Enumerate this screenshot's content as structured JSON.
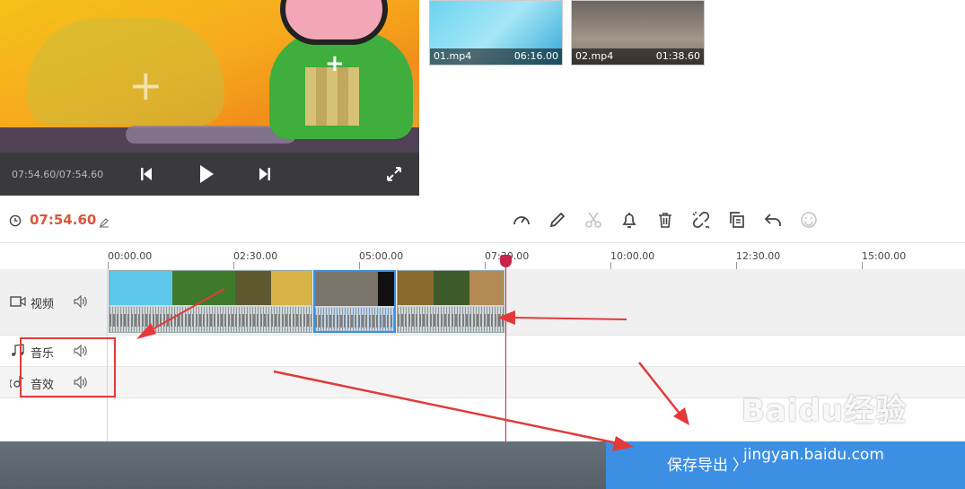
{
  "player": {
    "time_readout": "07:54.60/07:54.60",
    "icons": [
      "skip-back-icon",
      "play-icon",
      "skip-forward-icon",
      "fullscreen-icon"
    ]
  },
  "media_bin": [
    {
      "name": "01.mp4",
      "duration": "06:16.00"
    },
    {
      "name": "02.mp4",
      "duration": "01:38.60"
    }
  ],
  "toolbar": {
    "current_time": "07:54.60",
    "tools": [
      "speed-icon",
      "edit-icon",
      "cut-icon",
      "bell-icon",
      "delete-icon",
      "unlink-icon",
      "copy-icon",
      "undo-icon",
      "emoji-icon"
    ]
  },
  "ruler": {
    "labels": [
      "00:00.00",
      "02:30.00",
      "05:00.00",
      "07:30.00",
      "10:00.00",
      "12:30.00",
      "15:00.00"
    ]
  },
  "tracks": {
    "video": "视频",
    "music": "音乐",
    "sfx": "音效"
  },
  "export": {
    "label": "保存导出 〉"
  },
  "watermark": {
    "brand": "Baidu经验",
    "url": "jingyan.baidu.com"
  },
  "colors": {
    "accent": "#d9573b",
    "playhead": "#c8234b",
    "export": "#3d8fe3",
    "annotation": "#e23a3a"
  }
}
